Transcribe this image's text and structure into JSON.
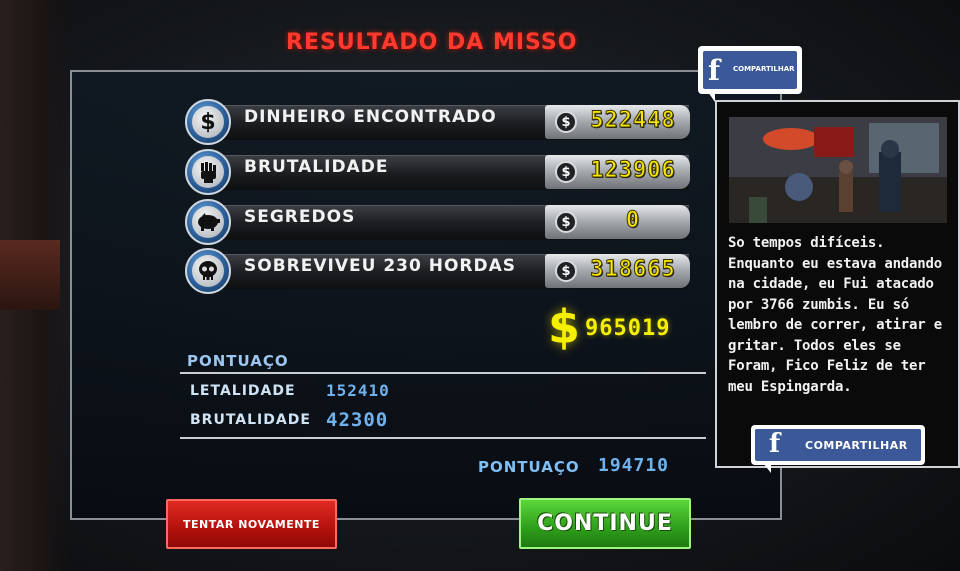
{
  "title": "RESULTADO DA MISSO",
  "rewards": [
    {
      "icon": "dollar-icon",
      "label": "DINHEIRO ENCONTRADO",
      "currency": "$",
      "value": "522448"
    },
    {
      "icon": "fist-icon",
      "label": "BRUTALIDADE",
      "currency": "$",
      "value": "123906"
    },
    {
      "icon": "piggy-bank-icon",
      "label": "SEGREDOS",
      "currency": "$",
      "value": "0"
    },
    {
      "icon": "skull-icon",
      "label": "SOBREVIVEU 230 HORDAS",
      "currency": "$",
      "value": "318665"
    }
  ],
  "total": {
    "currency": "$",
    "value": "965019"
  },
  "score": {
    "heading": "PONTUAÇO",
    "stats": [
      {
        "label": "LETALIDADE",
        "value": "152410"
      },
      {
        "label": "BRUTALIDADE",
        "value": "42300"
      }
    ],
    "final_label": "PONTUAÇO",
    "final_value": "194710"
  },
  "buttons": {
    "retry": "TENTAR NOVAMENTE",
    "continue": "CONTINUE"
  },
  "share": {
    "top_button": "COMPARTILHAR",
    "bottom_button": "COMPARTILHAR",
    "story": "So tempos difíceis. Enquanto eu estava andando na cidade, eu Fui atacado por 3766 zumbis. Eu só lembro de correr, atirar e gritar. Todos eles se Foram, Fico Feliz de ter meu Espingarda."
  },
  "colors": {
    "title": "#ff3a2e",
    "money": "#f6e600",
    "score": "#6fb2ee",
    "retry": "#c8140f",
    "continue": "#3fae22",
    "facebook": "#3b5998"
  }
}
